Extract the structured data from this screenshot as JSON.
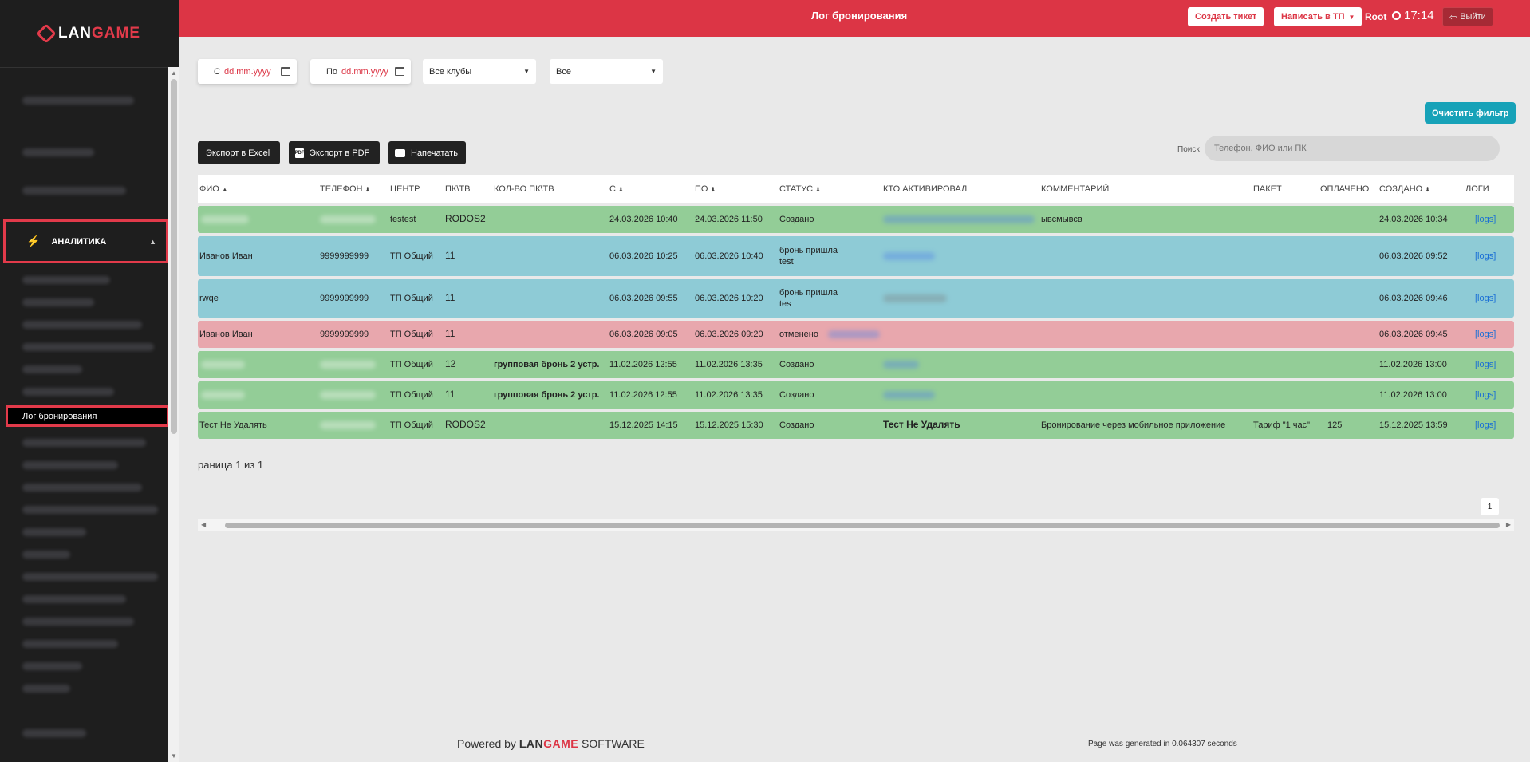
{
  "sidebar": {
    "logo_brand_a": "LAN",
    "logo_brand_b": "GAME",
    "analytics_label": "АНАЛИТИКА",
    "active_item": "Лог бронирования"
  },
  "header": {
    "title": "Лог бронирования",
    "create_ticket": "Создать тикет",
    "write_support": "Написать в ТП",
    "user": "Root",
    "time": "17:14",
    "logout": "Выйти"
  },
  "filters": {
    "from_label": "С",
    "to_label": "По",
    "date_placeholder": "dd.mm.yyyy",
    "clubs": "Все клубы",
    "status": "Все",
    "clear": "Очистить фильтр"
  },
  "toolbar": {
    "excel": "Экспорт в Excel",
    "pdf": "Экспорт в PDF",
    "pdf_icon_text": "PDF",
    "print": "Напечатать",
    "search_label": "Поиск",
    "search_placeholder": "Телефон, ФИО или ПК"
  },
  "table": {
    "headers": [
      "ФИО",
      "ТЕЛЕФОН",
      "ЦЕНТР",
      "ПК\\ТВ",
      "КОЛ-ВО ПК\\ТВ",
      "С",
      "ПО",
      "СТАТУС",
      "КТО АКТИВИРОВАЛ",
      "КОММЕНТАРИЙ",
      "ПАКЕТ",
      "ОПЛАЧЕНО",
      "СОЗДАНО",
      "ЛОГИ"
    ],
    "sort_up": "▲",
    "sort_both": "⬍",
    "rows": [
      {
        "fio": "",
        "phone": "",
        "center": "testest",
        "pc": "RODOS2",
        "count": "",
        "from": "24.03.2026 10:40",
        "to": "24.03.2026 11:50",
        "status": "Создано",
        "status2": "",
        "activated": "",
        "comment": "ывсмывсв",
        "package": "",
        "paid": "",
        "created": "24.03.2026 10:34",
        "logs": "[logs]"
      },
      {
        "fio": "Иванов Иван",
        "phone": "9999999999",
        "center": "ТП Общий",
        "pc": "11",
        "count": "",
        "from": "06.03.2026 10:25",
        "to": "06.03.2026 10:40",
        "status": "бронь пришла",
        "status2": "test",
        "activated": "",
        "comment": "",
        "package": "",
        "paid": "",
        "created": "06.03.2026 09:52",
        "logs": "[logs]"
      },
      {
        "fio": "rwqe",
        "phone": "9999999999",
        "center": "ТП Общий",
        "pc": "11",
        "count": "",
        "from": "06.03.2026 09:55",
        "to": "06.03.2026 10:20",
        "status": "бронь пришла",
        "status2": "tes",
        "activated": "",
        "comment": "",
        "package": "",
        "paid": "",
        "created": "06.03.2026 09:46",
        "logs": "[logs]"
      },
      {
        "fio": "Иванов Иван",
        "phone": "9999999999",
        "center": "ТП Общий",
        "pc": "11",
        "count": "",
        "from": "06.03.2026 09:05",
        "to": "06.03.2026 09:20",
        "status": "отменено",
        "status2": "",
        "activated": "",
        "comment": "",
        "package": "",
        "paid": "",
        "created": "06.03.2026 09:45",
        "logs": "[logs]"
      },
      {
        "fio": "",
        "phone": "",
        "center": "ТП Общий",
        "pc": "12",
        "count": "групповая бронь 2 устр.",
        "from": "11.02.2026 12:55",
        "to": "11.02.2026 13:35",
        "status": "Создано",
        "status2": "",
        "activated": "",
        "comment": "",
        "package": "",
        "paid": "",
        "created": "11.02.2026 13:00",
        "logs": "[logs]"
      },
      {
        "fio": "",
        "phone": "",
        "center": "ТП Общий",
        "pc": "11",
        "count": "групповая бронь 2 устр.",
        "from": "11.02.2026 12:55",
        "to": "11.02.2026 13:35",
        "status": "Создано",
        "status2": "",
        "activated": "",
        "comment": "",
        "package": "",
        "paid": "",
        "created": "11.02.2026 13:00",
        "logs": "[logs]"
      },
      {
        "fio": "Тест Не Удалять",
        "phone": "",
        "center": "ТП Общий",
        "pc": "RODOS2",
        "count": "",
        "from": "15.12.2025 14:15",
        "to": "15.12.2025 15:30",
        "status": "Создано",
        "status2": "",
        "activated": "Тест Не Удалять",
        "comment": "Бронирование через мобильное приложение",
        "package": "Тариф \"1 час\"",
        "paid": "125",
        "created": "15.12.2025 13:59",
        "logs": "[logs]"
      }
    ]
  },
  "pagination": {
    "text": "раница 1 из 1",
    "page": "1"
  },
  "footer": {
    "powered": "Powered by",
    "brand_a": "LAN",
    "brand_b": "GAME",
    "software": "SOFTWARE",
    "generated": "Page was generated in 0.064307 seconds"
  },
  "colors": {
    "header_red": "#dc3545",
    "row_green": "#93cd97",
    "row_blue": "#8ecbd6",
    "row_red": "#e8a7ad",
    "clear_button": "#17a2b8"
  }
}
